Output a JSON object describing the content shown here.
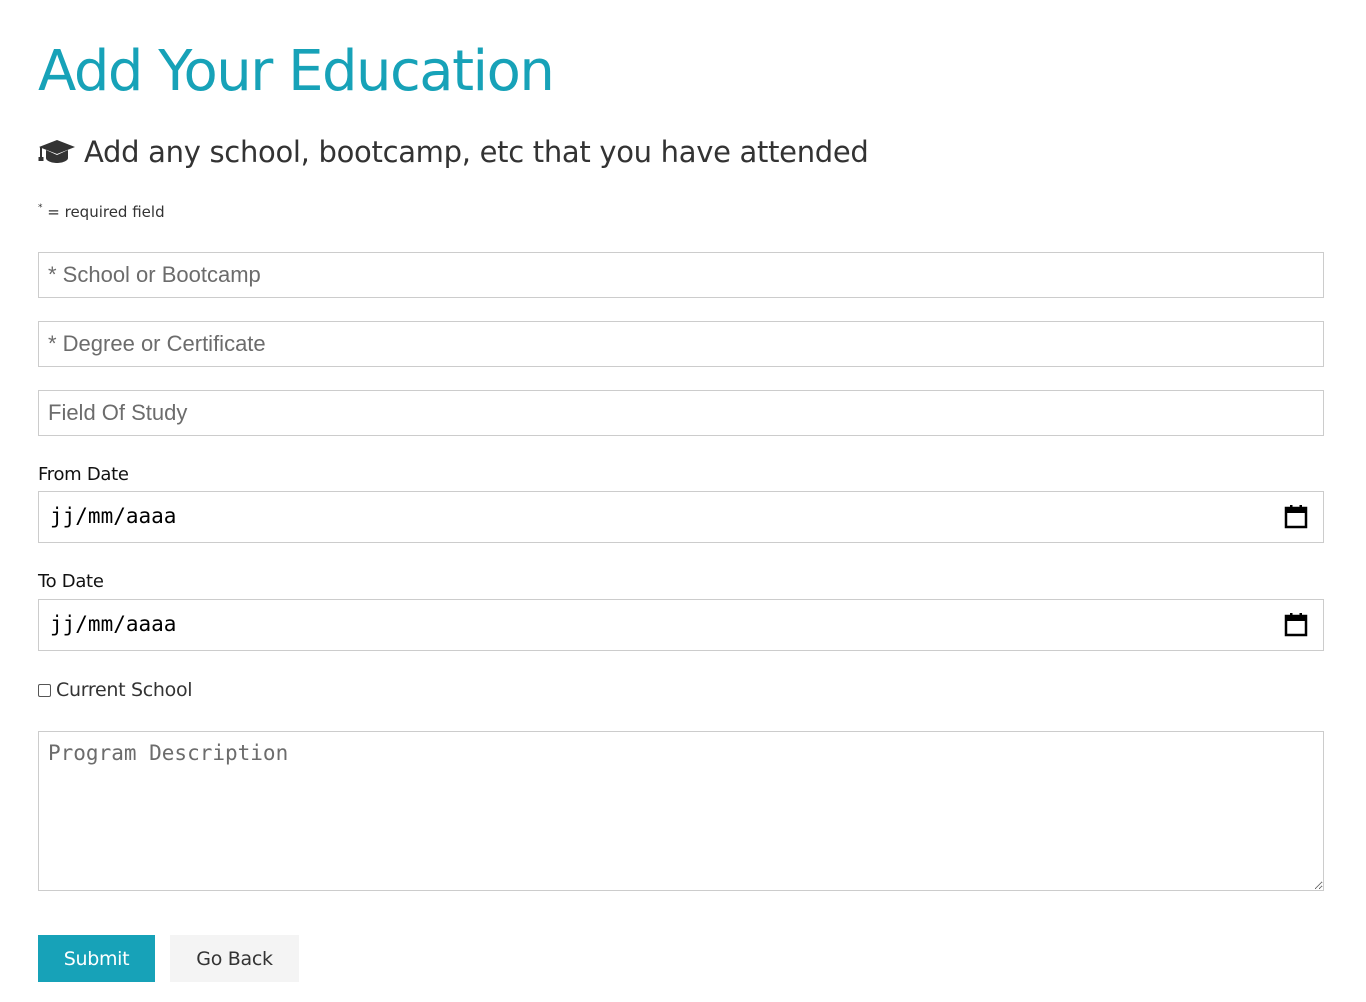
{
  "page": {
    "title": "Add Your Education",
    "lead": "Add any school, bootcamp, etc that you have attended",
    "lead_icon": "graduation-cap-icon",
    "required_note_star": "*",
    "required_note": " = required field"
  },
  "form": {
    "school": {
      "placeholder": "* School or Bootcamp",
      "value": ""
    },
    "degree": {
      "placeholder": "* Degree or Certificate",
      "value": ""
    },
    "field_of_study": {
      "placeholder": "Field Of Study",
      "value": ""
    },
    "from_date": {
      "label": "From Date",
      "value": "jj/mm/aaaa"
    },
    "to_date": {
      "label": "To Date",
      "value": "jj/mm/aaaa"
    },
    "current_school": {
      "label": "Current School",
      "checked": false
    },
    "description": {
      "placeholder": "Program Description",
      "value": ""
    }
  },
  "buttons": {
    "submit": "Submit",
    "go_back": "Go Back"
  },
  "colors": {
    "accent": "#17a2b8",
    "text": "#333333",
    "border": "#cccccc",
    "secondary_button": "#f4f4f4"
  }
}
